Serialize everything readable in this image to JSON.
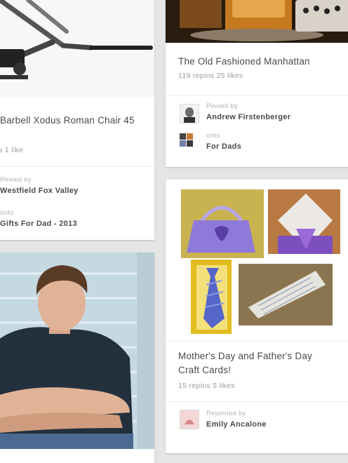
{
  "pins": [
    {
      "title": "Barbell Xodus Roman Chair 45",
      "stats": "s   1 like",
      "pinned_label": "Pinned by",
      "pinner": "Westfield Fox Valley",
      "onto_label": "onto",
      "board": "Gifts For Dad - 2013"
    },
    {
      "title": "The Old Fashioned Manhattan",
      "stats": "119 repins   25 likes",
      "pinned_label": "Pinned by",
      "pinner": "Andrew Firstenberger",
      "onto_label": "onto",
      "board": "For Dads"
    },
    {
      "title_line1": "Mother's Day and Father's Day",
      "title_line2": "Craft Cards!",
      "stats": "15 repins   5 likes",
      "pinned_label": "Repinned by",
      "pinner": "Emily Ancalone"
    }
  ],
  "colors": {
    "background": "#e5e5e5",
    "card": "#ffffff",
    "card_purple": "#8e7ad8",
    "board_tan": "#e8c24a"
  }
}
